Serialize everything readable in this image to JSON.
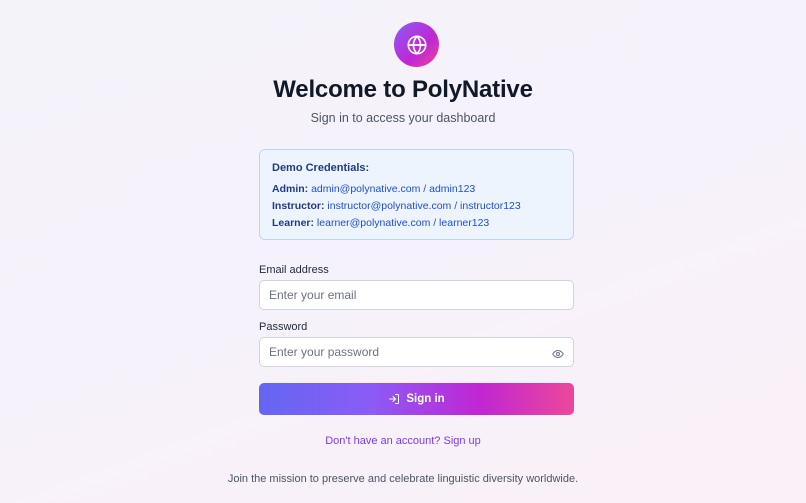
{
  "app": {
    "icon": "globe-icon",
    "title": "Welcome to PolyNative",
    "subtitle": "Sign in to access your dashboard"
  },
  "demo": {
    "heading": "Demo Credentials:",
    "admin_label": "Admin:",
    "admin_value": " admin@polynative.com / admin123",
    "instructor_label": "Instructor:",
    "instructor_value": " instructor@polynative.com / instructor123",
    "learner_label": "Learner:",
    "learner_value": " learner@polynative.com / learner123"
  },
  "form": {
    "email_label": "Email address",
    "email_placeholder": "Enter your email",
    "email_value": "",
    "password_label": "Password",
    "password_placeholder": "Enter your password",
    "password_value": "",
    "password_toggle_icon": "eye-icon",
    "signin_icon": "sign-in-icon",
    "signin_label": "Sign in"
  },
  "footer": {
    "signup_link": "Don't have an account? Sign up",
    "mission": "Join the mission to preserve and celebrate linguistic diversity worldwide."
  },
  "colors": {
    "accent_start": "#6366f1",
    "accent_end": "#ec4899",
    "link": "#7c3aed",
    "info_bg": "#eef4fd",
    "info_text": "#1d4ed8"
  }
}
